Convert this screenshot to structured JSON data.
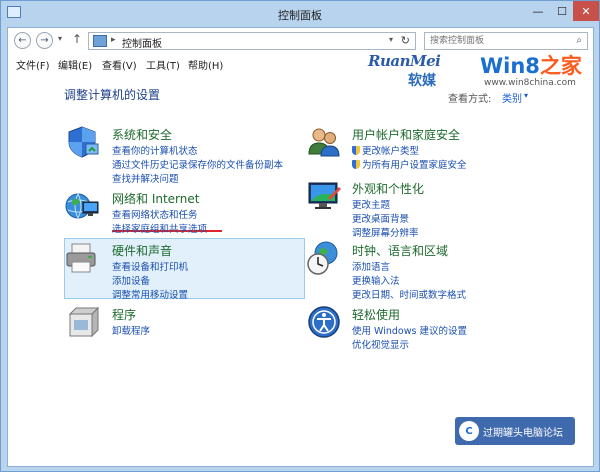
{
  "window": {
    "title": "控制面板",
    "min": "—",
    "max": "☐",
    "close": "✕"
  },
  "nav": {
    "back": "←",
    "forward": "→",
    "dropdown": "▾",
    "up": "↑",
    "address_sep": "▸",
    "address_path": "控制面板",
    "address_dd": "▾",
    "refresh": "↻",
    "search_placeholder": "搜索控制面板",
    "search_icon": "⌕"
  },
  "menu": [
    "文件(F)",
    "编辑(E)",
    "查看(V)",
    "工具(T)",
    "帮助(H)"
  ],
  "brand": {
    "ruanmei": "RuanMei",
    "ruanmei_cn": "软媒",
    "win8": "Win8",
    "zhijia": "之家",
    "url": "www.win8china.com"
  },
  "page": {
    "title": "调整计算机的设置",
    "view_by_label": "查看方式:",
    "view_by_value": "类别",
    "view_by_arrow": "▾"
  },
  "categories": [
    {
      "title": "系统和安全",
      "links": [
        "查看你的计算机状态",
        "通过文件历史记录保存你的文件备份副本",
        "查找并解决问题"
      ]
    },
    {
      "title": "网络和 Internet",
      "links": [
        "查看网络状态和任务",
        "选择家庭组和共享选项"
      ]
    },
    {
      "title": "硬件和声音",
      "links": [
        "查看设备和打印机",
        "添加设备",
        "调整常用移动设置"
      ]
    },
    {
      "title": "程序",
      "links": [
        "卸载程序"
      ]
    },
    {
      "title": "用户帐户和家庭安全",
      "links": [
        "更改帐户类型",
        "为所有用户设置家庭安全"
      ]
    },
    {
      "title": "外观和个性化",
      "links": [
        "更改主题",
        "更改桌面背景",
        "调整屏幕分辨率"
      ]
    },
    {
      "title": "时钟、语言和区域",
      "links": [
        "添加语言",
        "更换输入法",
        "更改日期、时间或数字格式"
      ]
    },
    {
      "title": "轻松使用",
      "links": [
        "使用 Windows 建议的设置",
        "优化视觉显示"
      ]
    }
  ],
  "forum": {
    "logo": "C",
    "text": "过期罐头电脑论坛",
    "url": "www.gqgtpc.com"
  },
  "colors": {
    "link": "#1a4fb0",
    "category_title": "#1e6a2e",
    "page_title": "#1e3f8a",
    "highlight": "#e2f0fb",
    "underline": "#e0242a"
  }
}
